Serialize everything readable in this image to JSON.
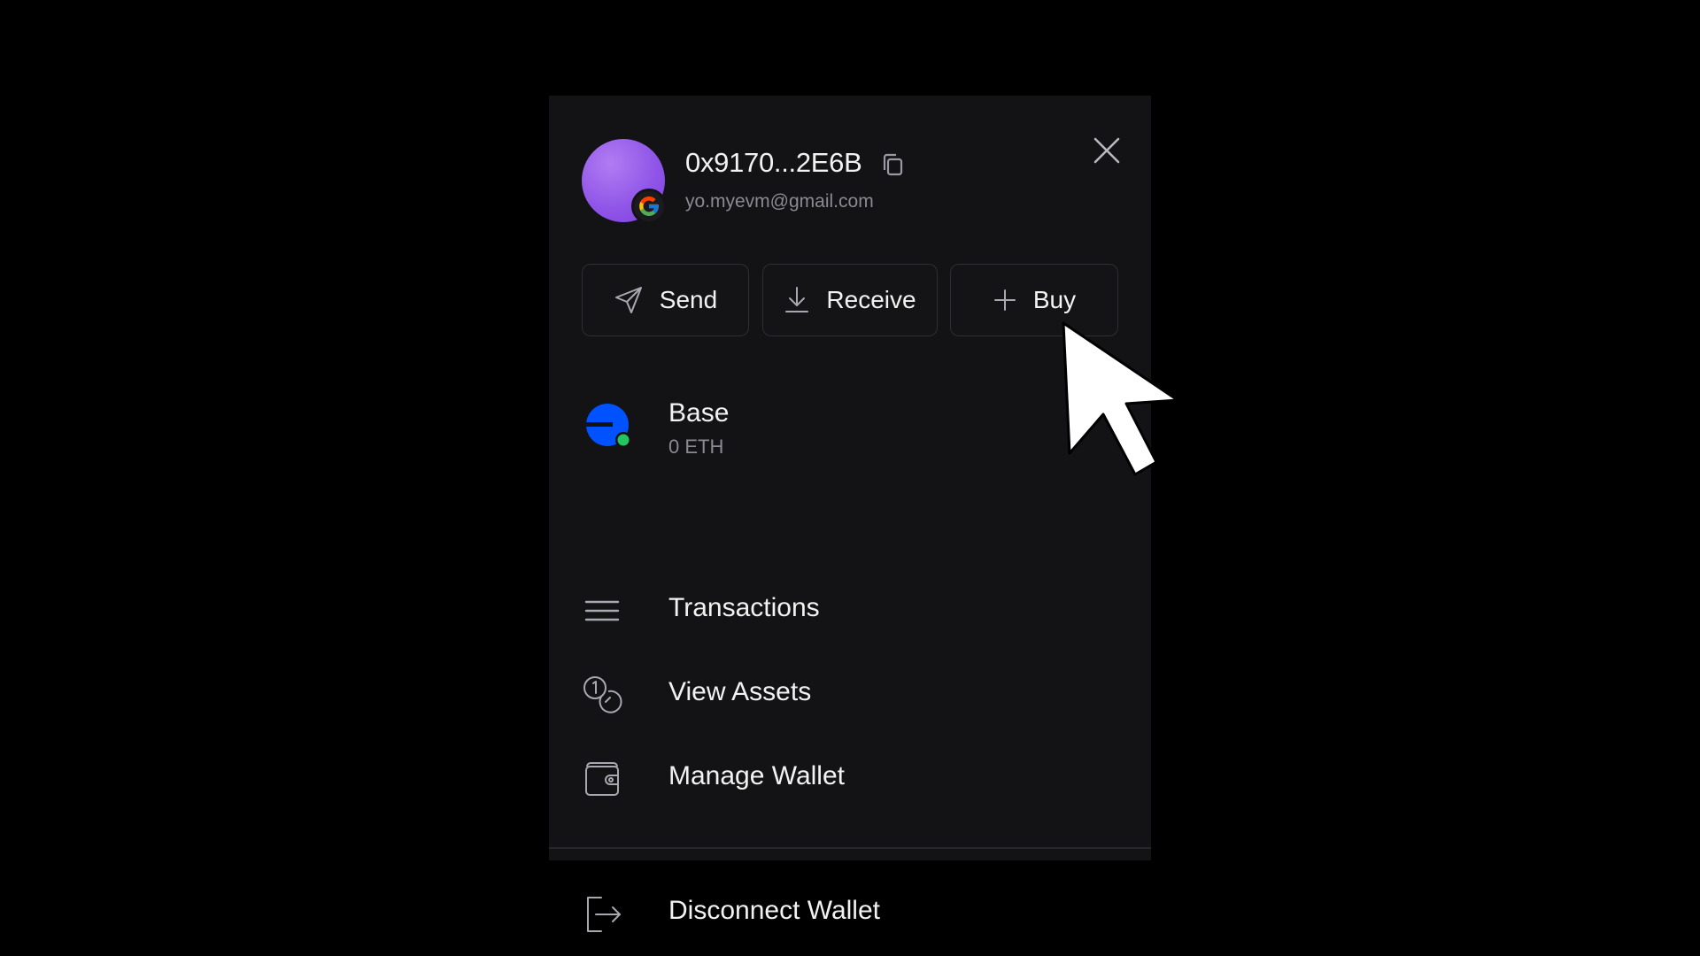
{
  "wallet": {
    "address": "0x9170...2E6B",
    "email": "yo.myevm@gmail.com",
    "avatar_gradient": [
      "#b07cf2",
      "#7c3fe0"
    ]
  },
  "actions": {
    "send": "Send",
    "receive": "Receive",
    "buy": "Buy"
  },
  "network": {
    "name": "Base",
    "balance": "0 ETH",
    "color": "#0052ff",
    "status_color": "#22c55e"
  },
  "menu": {
    "transactions": "Transactions",
    "view_assets": "View Assets",
    "manage_wallet": "Manage Wallet",
    "disconnect": "Disconnect Wallet"
  },
  "icons": {
    "login_provider": "google-icon",
    "copy": "copy-icon",
    "close": "close-icon",
    "send": "send-icon",
    "receive": "download-icon",
    "buy": "plus-icon",
    "network": "base-network-icon",
    "transactions": "list-icon",
    "view_assets": "coins-icon",
    "manage_wallet": "wallet-icon",
    "disconnect": "logout-icon",
    "pointer": "mouse-cursor-icon"
  }
}
